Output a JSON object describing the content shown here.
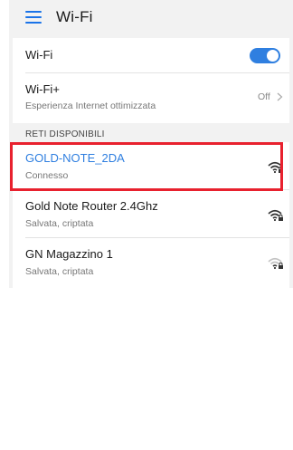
{
  "header": {
    "title": "Wi-Fi",
    "menu_icon": "hamburger-menu-icon"
  },
  "settings": {
    "wifi_label": "Wi-Fi",
    "wifi_enabled": true,
    "wifiplus_label": "Wi-Fi+",
    "wifiplus_sub": "Esperienza Internet ottimizzata",
    "wifiplus_value": "Off"
  },
  "networks_section": {
    "header": "RETI DISPONIBILI",
    "items": [
      {
        "name": "GOLD-NOTE_2DA",
        "status": "Connesso",
        "connected": true,
        "icon": "wifi-lock-icon"
      },
      {
        "name": "Gold Note Router 2.4Ghz",
        "status": "Salvata, criptata",
        "connected": false,
        "icon": "wifi-lock-icon"
      },
      {
        "name": "GN Magazzino 1",
        "status": "Salvata, criptata",
        "connected": false,
        "icon": "wifi-lock-weak-icon"
      }
    ]
  },
  "colors": {
    "accent": "#2f7fe0",
    "highlight": "#e8212e",
    "background": "#f2f2f2"
  }
}
